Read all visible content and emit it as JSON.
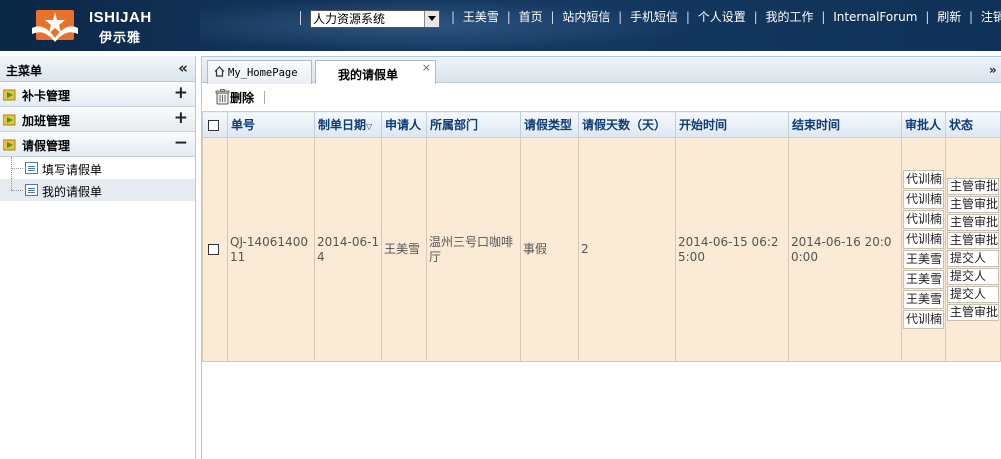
{
  "header": {
    "brand_en": "ISHIJAH",
    "brand_cn": "伊示雅",
    "system_select": "人力资源系统",
    "nav": [
      "王美雪",
      "首页",
      "站内短信",
      "手机短信",
      "个人设置",
      "我的工作",
      "InternalForum",
      "刷新",
      "注销"
    ]
  },
  "sidebar": {
    "title": "主菜单",
    "collapse_glyph": "«",
    "groups": [
      {
        "label": "补卡管理",
        "toggle": "+"
      },
      {
        "label": "加班管理",
        "toggle": "+"
      },
      {
        "label": "请假管理",
        "toggle": "−"
      }
    ],
    "sub_items": [
      {
        "label": "填写请假单"
      },
      {
        "label": "我的请假单"
      }
    ]
  },
  "tabs": {
    "home": "My_HomePage",
    "active": "我的请假单",
    "close_glyph": "×",
    "scroll_glyph": "»"
  },
  "toolbar": {
    "delete_label": "删除"
  },
  "table": {
    "headers": [
      "单号",
      "制单日期",
      "申请人",
      "所属部门",
      "请假类型",
      "请假天数（天）",
      "开始时间",
      "结束时间",
      "审批人",
      "状态"
    ],
    "row": {
      "order_no": "QJ-1406140011",
      "created_date": "2014-06-14",
      "applicant": "王美雪",
      "department": "温州三号口咖啡厅",
      "leave_type": "事假",
      "days": "2",
      "start_time": "2014-06-15 06:25:00",
      "end_time": "2014-06-16 20:00:00",
      "approvers": [
        "代训楠",
        "代训楠",
        "代训楠",
        "代训楠",
        "王美雪",
        "王美雪",
        "王美雪",
        "代训楠"
      ],
      "statuses": [
        "主管审批",
        "主管审批",
        "主管审批",
        "主管审批",
        "提交人",
        "提交人",
        "提交人",
        "主管审批"
      ]
    }
  },
  "colors": {
    "header_bg": "#163a63",
    "row_bg": "#fbebd6",
    "header_text": "#0d3c78",
    "logo_orange": "#e8722a"
  }
}
